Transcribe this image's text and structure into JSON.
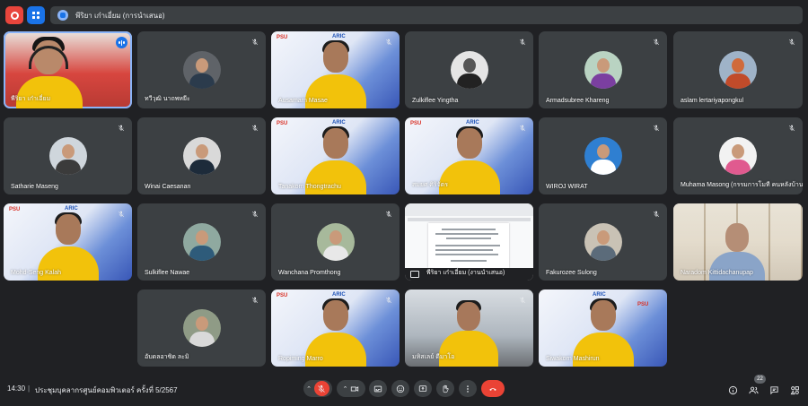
{
  "topbar": {
    "presenter_text": "พีริยา เก๋าเอี่ยม (การนำเสนอ)"
  },
  "participants": {
    "self": "พีริยา เก๋าเอี่ยม",
    "p2": "ทวีวุฒิ นาถพหยีะ",
    "p3": "Ausamarn Masae",
    "p4": "Zulkiflee Yingtha",
    "p5": "Armadsubree Khareng",
    "p6": "aslam lertariyapongkul",
    "p7": "Satharie Maseng",
    "p8": "Winai Caesanan",
    "p9": "Tanakorn Thongtrachu",
    "p10": "สมยศ ศิริจัตร",
    "p11": "WIROJ WIRAT",
    "p12": "Muhama Masong (กรรมการโมที คนหลังบ้าน)",
    "p13": "Mohd-Seng Kalah",
    "p14": "Sulkiflee Nawae",
    "p15": "Wanchana Promthong",
    "p16_share": "พีริยา เก๋าเอี่ยม (งานนำเสนอ)",
    "p17": "Fakurozee Sulong",
    "p18": "Naradom Kittidachanupap",
    "p19": "อับดลอาซิด ละมิ",
    "p20": "Ropiming Marro",
    "p21": "มหิสเลย์ ดีมาโอ",
    "p22": "Siwakorn Mashirun"
  },
  "video_logos": {
    "left": "PSU",
    "right": "ARIC"
  },
  "bottombar": {
    "time": "14:30",
    "separator": "|",
    "meeting_title": "ประชุมบุคลากรศูนย์คอมพิวเตอร์ ครั้งที่ 5/2567",
    "participant_count": "22"
  },
  "colors": {
    "background": "#202124",
    "tile": "#3c4043",
    "accent": "#1a73e8",
    "end_call": "#ea4335"
  },
  "icons": [
    "record-icon",
    "activities-icon",
    "mic-off-icon",
    "speaking-icon",
    "camera-icon",
    "captions-icon",
    "emoji-icon",
    "present-icon",
    "raise-hand-icon",
    "more-icon",
    "end-call-icon",
    "info-icon",
    "people-icon",
    "chat-icon",
    "shapes-icon"
  ]
}
